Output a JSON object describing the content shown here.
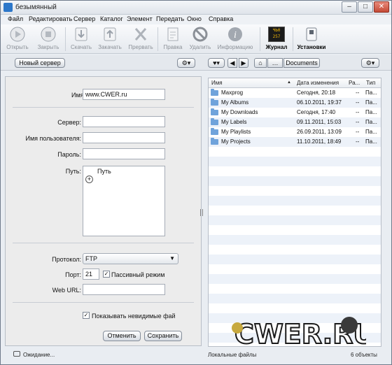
{
  "window": {
    "title": "безымянный",
    "controls": [
      "–",
      "□",
      "✕"
    ]
  },
  "menu": [
    "Файл",
    "Редактировать",
    "Сервер",
    "Каталог",
    "Элемент",
    "Передать",
    "Окно",
    "Справка"
  ],
  "toolbar": {
    "connect": "Открыть",
    "disconnect": "Закрыть",
    "download": "Скачать",
    "upload": "Закачать",
    "cancel": "Прервать",
    "edit": "Правка",
    "delete": "Удалить",
    "info": "Информацию",
    "log": "Журнал",
    "log_badge": "ЧЬ0 257",
    "settings": "Установки"
  },
  "subbar": {
    "new_server": "Новый сервер",
    "gear": "⚙▾",
    "heart": "♥▾",
    "back": "◀",
    "forward": "▶",
    "home": "⌂",
    "ellipsis": "…",
    "path": "Documents"
  },
  "form": {
    "name_label": "Имя:",
    "name_value": "www.CWER.ru",
    "server_label": "Сервер:",
    "server_value": "",
    "user_label": "Имя пользователя:",
    "user_value": "",
    "password_label": "Пароль:",
    "password_value": "",
    "path_label": "Путь:",
    "path_column": "Путь",
    "add": "+",
    "protocol_label": "Протокол:",
    "protocol_value": "FTP",
    "port_label": "Порт:",
    "port_value": "21",
    "passive": "Пассивный режим",
    "weburl_label": "Web URL:",
    "weburl_value": "",
    "show_hidden": "Показывать невидимые фай",
    "cancel": "Отменить",
    "save": "Сохранить",
    "passive_checked": true,
    "show_hidden_checked": true
  },
  "files": {
    "columns": [
      "Имя",
      "Дата изменения",
      "Ра...",
      "Тип"
    ],
    "rows": [
      {
        "name": "Maxprog",
        "date": "Сегодня, 20:18",
        "size": "--",
        "type": "Па..."
      },
      {
        "name": "My Albums",
        "date": "06.10.2011, 19:37",
        "size": "--",
        "type": "Па..."
      },
      {
        "name": "My Downloads",
        "date": "Сегодня, 17:40",
        "size": "--",
        "type": "Па..."
      },
      {
        "name": "My Labels",
        "date": "09.11.2011, 15:03",
        "size": "--",
        "type": "Па..."
      },
      {
        "name": "My Playlists",
        "date": "26.09.2011, 13:09",
        "size": "--",
        "type": "Па..."
      },
      {
        "name": "My Projects",
        "date": "11.10.2011, 18:49",
        "size": "--",
        "type": "Па..."
      }
    ]
  },
  "status": {
    "left": "Ожидание...",
    "middle": "Локальные файлы",
    "right": "6 объекты"
  },
  "watermark": "CWER.RU",
  "colors": {
    "accent": "#2c77c9",
    "folder": "#6fa3db",
    "window_bg": "#e9edf2"
  }
}
